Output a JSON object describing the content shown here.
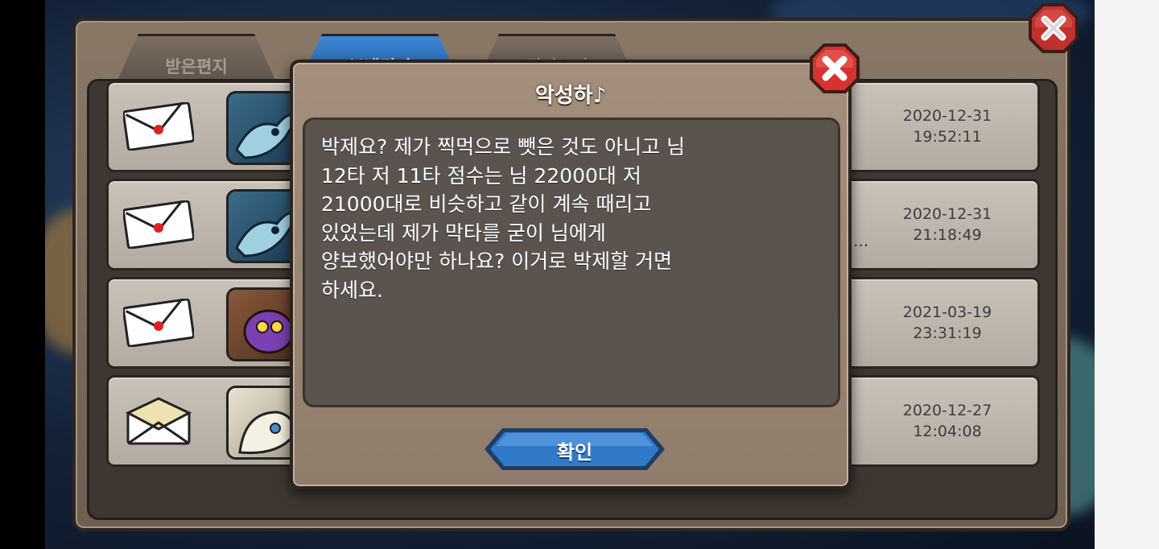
{
  "tabs": {
    "received": "받은편지",
    "sent": "보낸편지",
    "compose": "편지쓰기"
  },
  "mail_rows": [
    {
      "date": "2020-12-31",
      "time": "19:52:11",
      "status": "unread",
      "portrait": "blue-dragon-skeleton"
    },
    {
      "date": "2020-12-31",
      "time": "21:18:49",
      "status": "unread",
      "portrait": "blue-dragon-skeleton",
      "ellipsis": "..."
    },
    {
      "date": "2021-03-19",
      "time": "23:31:19",
      "status": "unread",
      "portrait": "purple-baby-dragon"
    },
    {
      "date": "2020-12-27",
      "time": "12:04:08",
      "status": "read",
      "portrait": "white-dragon"
    }
  ],
  "modal": {
    "title": "악성하♪",
    "message": "박제요? 제가 찍먹으로 뺏은 것도 아니고 님\n12타 저 11타 점수는 님 22000대 저\n21000대로 비슷하고 같이 계속 때리고\n있었는데 제가 막타를 굳이 님에게\n양보했어야만 하나요? 이거로 박제할 거면\n하세요.",
    "confirm_label": "확인"
  },
  "icons": {
    "modal_close": "close-x-icon",
    "panel_close": "close-x-icon",
    "envelope_unread": "sealed-envelope-icon",
    "envelope_read": "open-envelope-icon"
  },
  "colors": {
    "close_red": "#d7322f",
    "confirm_blue": "#2f74c4",
    "panel_brown": "#8a7867",
    "row_bg": "#c1b9af"
  }
}
